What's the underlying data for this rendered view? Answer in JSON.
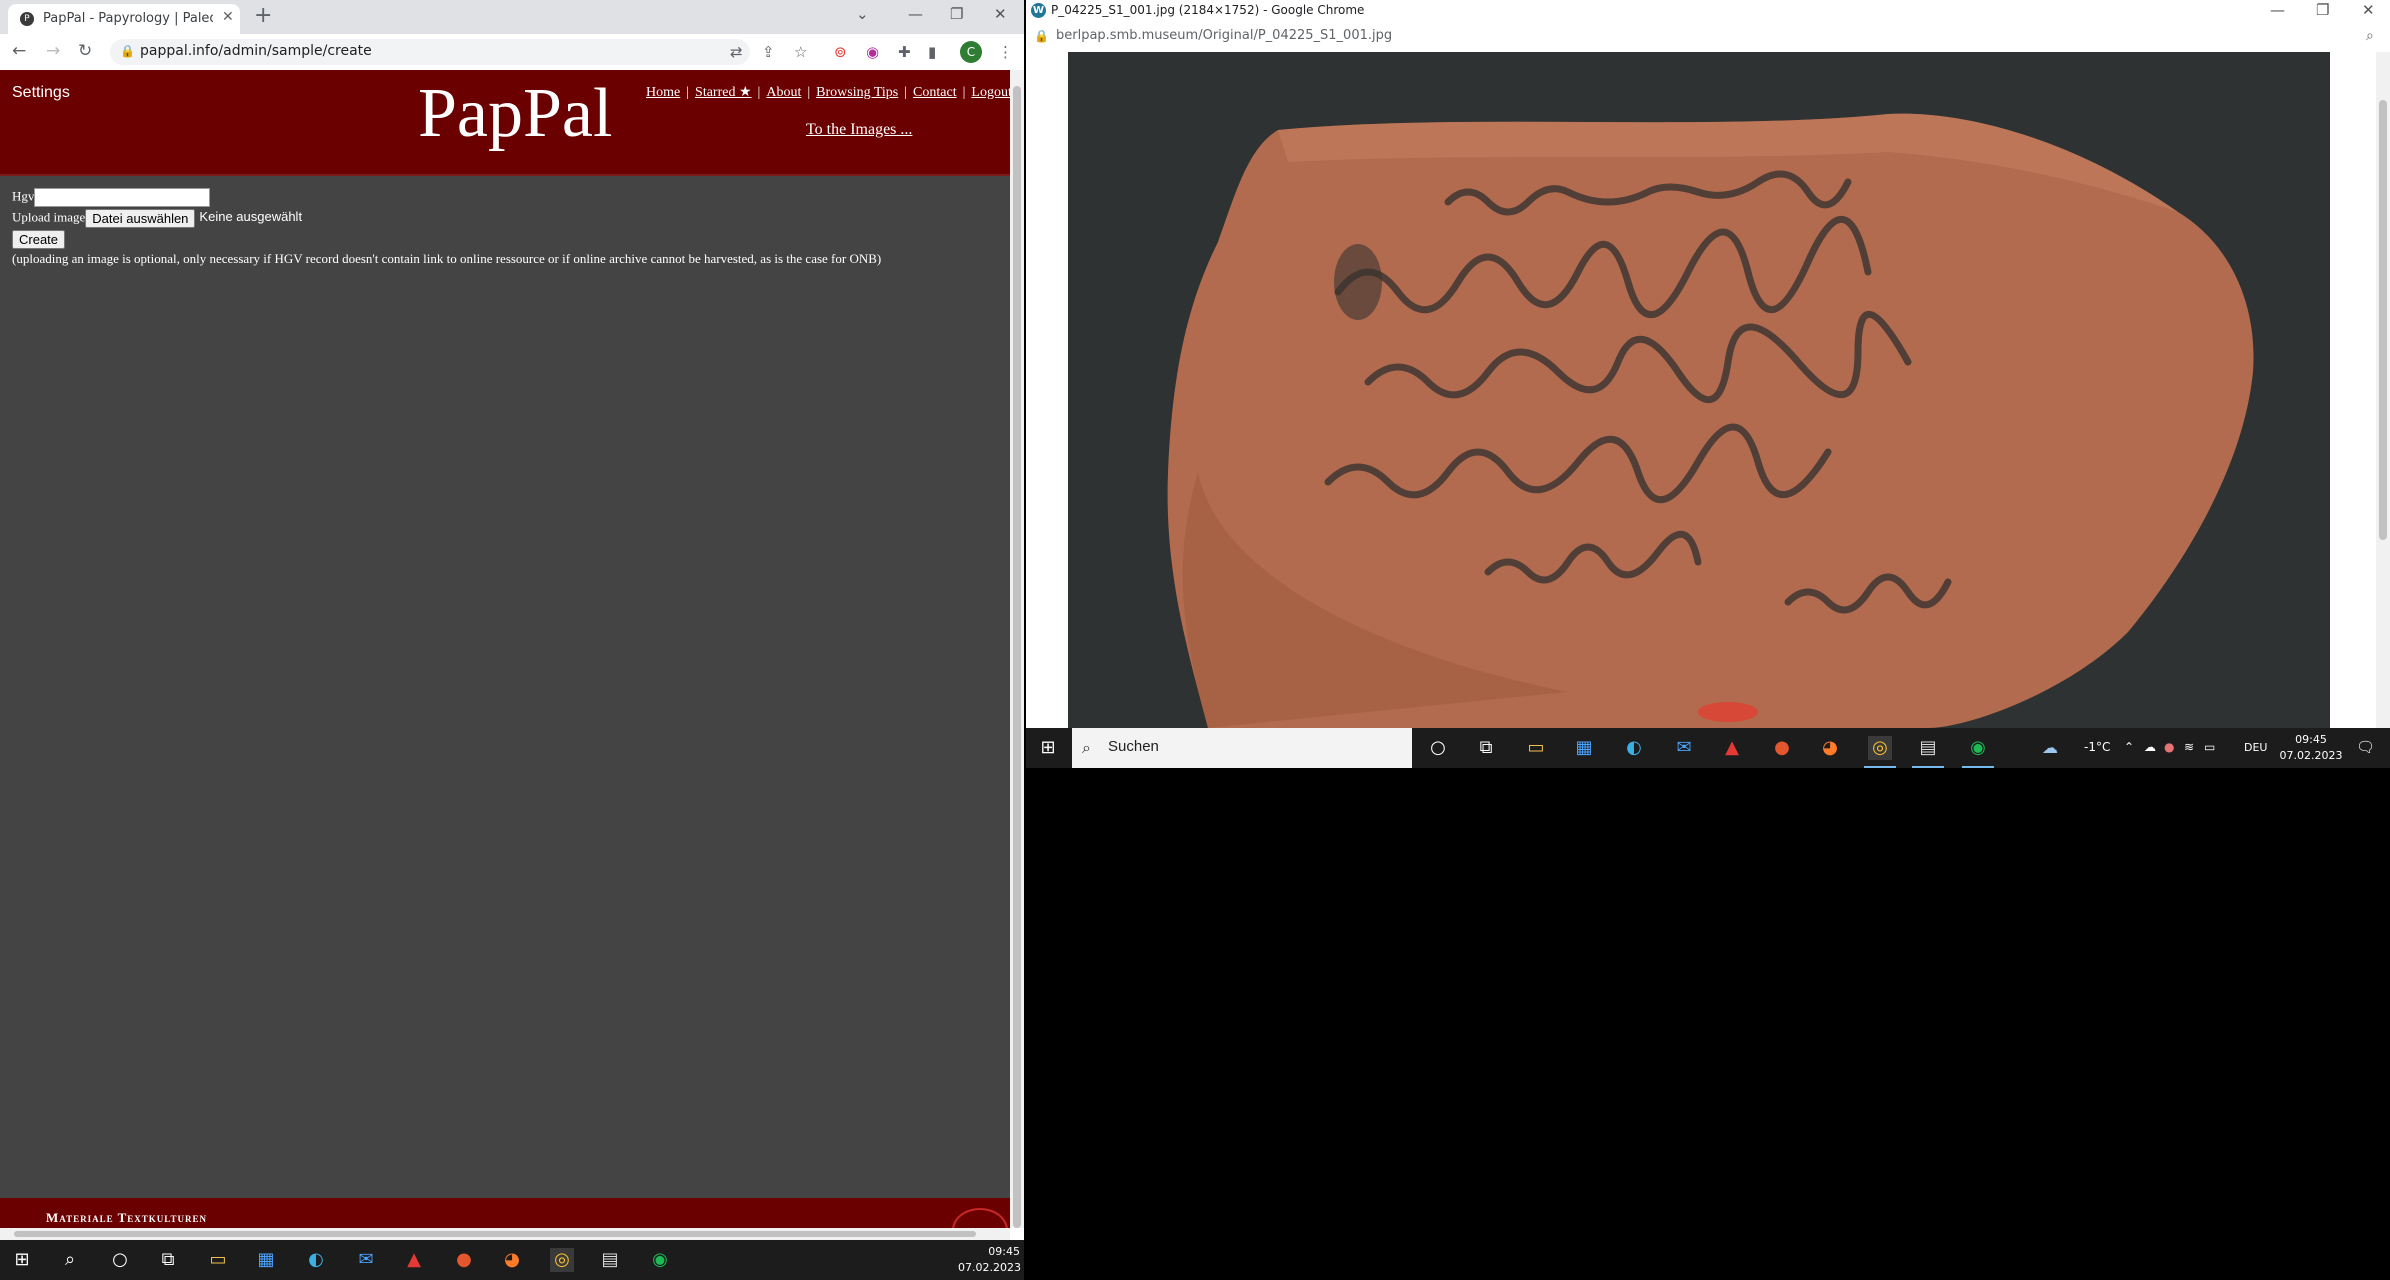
{
  "left_window": {
    "tab_title": "PapPal - Papyrology | Paleography",
    "url": "pappal.info/admin/sample/create",
    "profile_initial": "C",
    "site": {
      "settings_label": "Settings",
      "logo": "PapPal",
      "nav": [
        "Home",
        "Starred ★",
        "About",
        "Browsing Tips",
        "Contact",
        "Logout"
      ],
      "to_images": "To the Images ...",
      "form": {
        "hgv_label": "Hgv",
        "hgv_value": "",
        "upload_label": "Upload image",
        "file_button": "Datei auswählen",
        "no_file": "Keine ausgewählt",
        "create_button": "Create",
        "note": "(uploading an image is optional, only necessary if HGV record doesn't contain link to online ressource or if online archive cannot be harvested, as is the case for ONB)"
      },
      "footer_text": "Materiale Textkulturen"
    }
  },
  "left_taskbar": {
    "time": "09:45",
    "date": "07.02.2023"
  },
  "right_window": {
    "title": "P_04225_S1_001.jpg (2184×1752) - Google Chrome",
    "url": "berlpap.smb.museum/Original/P_04225_S1_001.jpg"
  },
  "right_taskbar": {
    "search_placeholder": "Suchen",
    "weather": "-1°C",
    "language": "DEU",
    "time": "09:45",
    "date": "07.02.2023"
  },
  "colors": {
    "banner": "#6b0000",
    "page_bg": "#444444",
    "taskbar": "#1c1c1c",
    "sherd": "#b26b4f",
    "cloth": "#2f3232"
  }
}
